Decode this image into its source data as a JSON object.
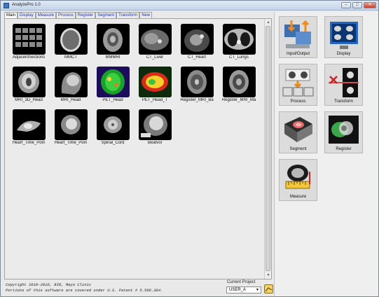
{
  "window": {
    "title": "AnalyzePro 1.0",
    "minimize": "–",
    "maximize": "□",
    "close": "✕"
  },
  "tabs": [
    "Main",
    "Display",
    "Measure",
    "Process",
    "Register",
    "Segment",
    "Transform",
    "New"
  ],
  "thumbnails": [
    "AdjacentSections",
    "MMCT",
    "MMMRI",
    "CT_Liver",
    "CT_Heart",
    "CT_Lungs",
    "MRI_3D_Head",
    "MRI_Head",
    "PET_Head",
    "PET_Head_T",
    "Register_MRI_Ba",
    "Register_MRI_Ma",
    "Heart_Time_Poin",
    "Heart_Time_Poin",
    "Spinal_Cord",
    "Beatvol"
  ],
  "footer": {
    "copyright_line1": "Copyright 2010-2018, BIR, Mayo Clinic",
    "copyright_line2": "Portions of this software are covered under U.S. Patent # 5.568.384.",
    "project_label": "Current Project",
    "project_value": "USER_A"
  },
  "tools": [
    "Input/Output",
    "Display",
    "Process",
    "Transform",
    "Segment",
    "Register",
    "Measure"
  ],
  "colors": {
    "accent": "#1a2fb0",
    "pet_green": "#1aa02a",
    "brain_gray": "#9a9a9a"
  }
}
